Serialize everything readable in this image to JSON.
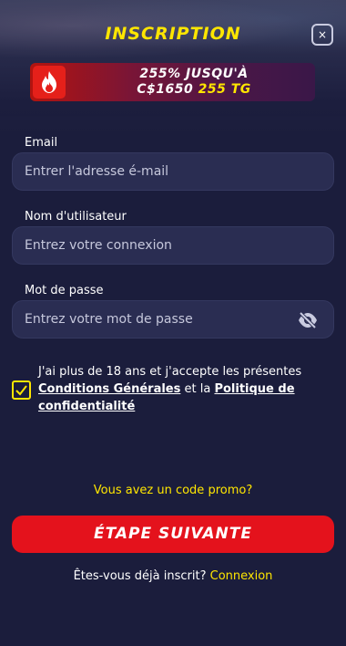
{
  "header": {
    "title": "INSCRIPTION",
    "close_icon": "×"
  },
  "promo": {
    "icon": "fire-icon",
    "line1": "255% JUSQU'À",
    "line2_amount": "C$1650",
    "line2_bonus": "255 TG"
  },
  "form": {
    "email": {
      "label": "Email",
      "placeholder": "Entrer l'adresse é-mail"
    },
    "username": {
      "label": "Nom d'utilisateur",
      "placeholder": "Entrez votre connexion"
    },
    "password": {
      "label": "Mot de passe",
      "placeholder": "Entrez votre mot de passe",
      "toggle_icon": "eye-off-icon"
    }
  },
  "terms": {
    "checked": true,
    "text_before": "J'ai plus de 18 ans et j'accepte les présentes ",
    "link1": "Conditions Générales",
    "text_middle": " et la ",
    "link2": "Politique de confidentialité"
  },
  "promo_code_link": "Vous avez un code promo?",
  "next_button": "ÉTAPE SUIVANTE",
  "login": {
    "question": "Êtes-vous déjà inscrit?",
    "link": "Connexion"
  },
  "colors": {
    "background": "#1b1d3c",
    "accent": "#ffe600",
    "primary_button": "#e4121c"
  }
}
